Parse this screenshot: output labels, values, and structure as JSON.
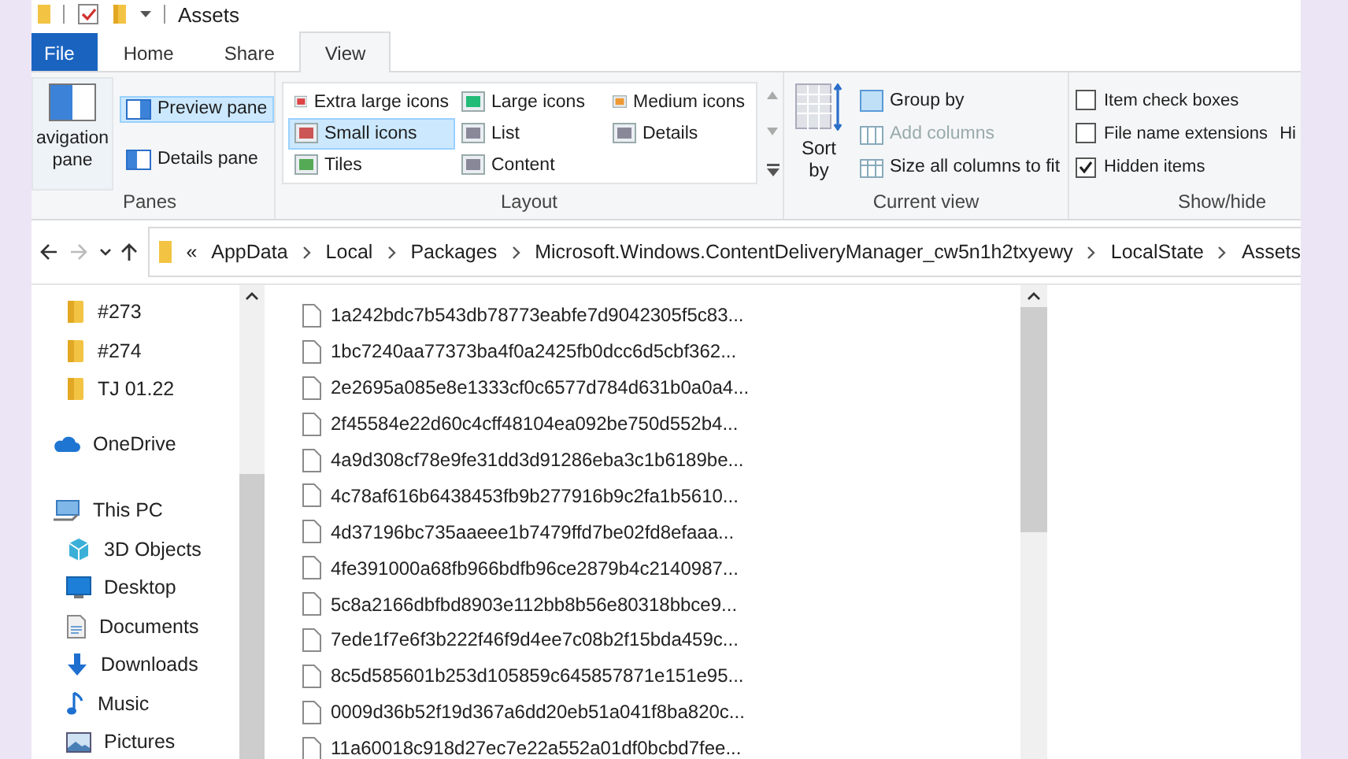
{
  "title_bar": {
    "title": "Assets"
  },
  "tabs": [
    {
      "label": "File",
      "kind": "file",
      "selected": false
    },
    {
      "label": "Home",
      "kind": "tab",
      "selected": false
    },
    {
      "label": "Share",
      "kind": "tab",
      "selected": false
    },
    {
      "label": "View",
      "kind": "tab",
      "selected": true
    }
  ],
  "ribbon": {
    "panes": {
      "label": "Panes",
      "navigation_pane": "avigation pane",
      "buttons": [
        {
          "label": "Preview pane",
          "selected": true
        },
        {
          "label": "Details pane",
          "selected": false
        }
      ]
    },
    "layout": {
      "label": "Layout",
      "options": [
        {
          "label": "Extra large icons",
          "selected": false
        },
        {
          "label": "Large icons",
          "selected": false
        },
        {
          "label": "Medium icons",
          "selected": false
        },
        {
          "label": "Small icons",
          "selected": true
        },
        {
          "label": "List",
          "selected": false
        },
        {
          "label": "Details",
          "selected": false
        },
        {
          "label": "Tiles",
          "selected": false
        },
        {
          "label": "Content",
          "selected": false
        }
      ]
    },
    "current_view": {
      "label": "Current view",
      "sort_by": "Sort by",
      "commands": [
        {
          "label": "Group by",
          "kind": "group",
          "disabled": false
        },
        {
          "label": "Add columns",
          "kind": "columns",
          "disabled": true
        },
        {
          "label": "Size all columns to fit",
          "kind": "fit",
          "disabled": false
        }
      ]
    },
    "show_hide": {
      "label": "Show/hide",
      "options": [
        {
          "label": "Item check boxes",
          "checked": false
        },
        {
          "label": "File name extensions",
          "checked": false
        },
        {
          "label": "Hidden items",
          "checked": true
        }
      ],
      "cut_button": "Hi"
    }
  },
  "address_bar": {
    "overflow": "«",
    "segments": [
      "AppData",
      "Local",
      "Packages",
      "Microsoft.Windows.ContentDeliveryManager_cw5n1h2txyewy",
      "LocalState",
      "Assets"
    ]
  },
  "nav_pane": {
    "quick_access": [
      {
        "label": "#273",
        "kind": "folder"
      },
      {
        "label": "#274",
        "kind": "folder"
      },
      {
        "label": "TJ 01.22",
        "kind": "folder"
      }
    ],
    "items": [
      {
        "label": "OneDrive",
        "kind": "cloud"
      },
      {
        "label": "This PC",
        "kind": "pc",
        "children": [
          {
            "label": "3D Objects",
            "kind": "cube"
          },
          {
            "label": "Desktop",
            "kind": "desktop"
          },
          {
            "label": "Documents",
            "kind": "documents"
          },
          {
            "label": "Downloads",
            "kind": "downloads"
          },
          {
            "label": "Music",
            "kind": "music"
          },
          {
            "label": "Pictures",
            "kind": "pictures"
          }
        ]
      }
    ]
  },
  "files": [
    "1a242bdc7b543db78773eabfe7d9042305f5c83...",
    "1bc7240aa77373ba4f0a2425fb0dcc6d5cbf362...",
    "2e2695a085e8e1333cf0c6577d784d631b0a0a4...",
    "2f45584e22d60c4cff48104ea092be750d552b4...",
    "4a9d308cf78e9fe31dd3d91286eba3c1b6189be...",
    "4c78af616b6438453fb9b277916b9c2fa1b5610...",
    "4d37196bc735aaeee1b7479ffd7be02fd8efaaa...",
    "4fe391000a68fb966bdfb96ce2879b4c2140987...",
    "5c8a2166dbfbd8903e112bb8b56e80318bbce9...",
    "7ede1f7e6f3b222f46f9d4ee7c08b2f15bda459c...",
    "8c5d585601b253d105859c645857871e151e95...",
    "0009d36b52f19d367a6dd20eb51a041f8ba820c...",
    "11a60018c918d27ec7e22a552a01df0bcbd7fee..."
  ]
}
